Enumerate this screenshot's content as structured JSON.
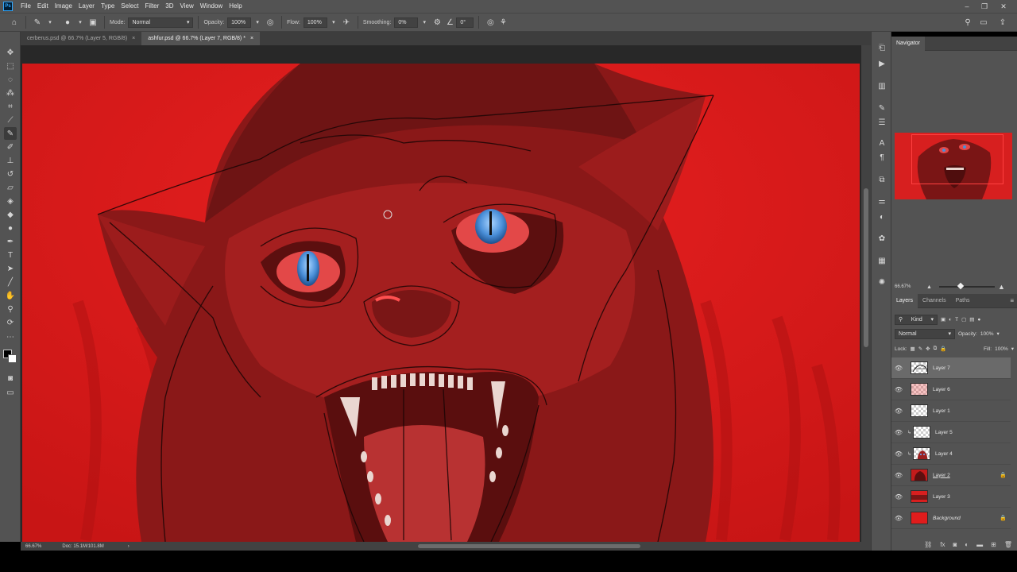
{
  "menubar": {
    "logo": "Ps",
    "items": [
      "File",
      "Edit",
      "Image",
      "Layer",
      "Type",
      "Select",
      "Filter",
      "3D",
      "View",
      "Window",
      "Help"
    ],
    "window_controls": [
      "–",
      "❐",
      "✕"
    ]
  },
  "options": {
    "mode_label": "Mode:",
    "mode_value": "Normal",
    "opacity_label": "Opacity:",
    "opacity_value": "100%",
    "flow_label": "Flow:",
    "flow_value": "100%",
    "smoothing_label": "Smoothing:",
    "smoothing_value": "0%",
    "angle_value": "0°"
  },
  "tabs": [
    {
      "label": "cerberus.psd @ 66.7% (Layer 5, RGB/8)",
      "close": "×",
      "active": false
    },
    {
      "label": "ashfur.psd @ 66.7% (Layer 7, RGB/8) *",
      "close": "×",
      "active": true
    }
  ],
  "status": {
    "zoom": "66.67%",
    "doc": "Doc: 15.1M/101.8M"
  },
  "navigator": {
    "title": "Navigator",
    "zoom": "66.67%"
  },
  "layers_panel": {
    "tabs": [
      "Layers",
      "Channels",
      "Paths"
    ],
    "filter_kind": "Kind",
    "blend_mode": "Normal",
    "opacity_label": "Opacity:",
    "opacity_value": "100%",
    "lock_label": "Lock:",
    "fill_label": "Fill:",
    "fill_value": "100%",
    "layers": [
      {
        "name": "Layer 7",
        "selected": true,
        "locked": false,
        "clipped": false
      },
      {
        "name": "Layer 6",
        "selected": false,
        "locked": false,
        "clipped": false
      },
      {
        "name": "Layer 1",
        "selected": false,
        "locked": false,
        "clipped": false
      },
      {
        "name": "Layer 5",
        "selected": false,
        "locked": false,
        "clipped": true
      },
      {
        "name": "Layer 4",
        "selected": false,
        "locked": false,
        "clipped": true
      },
      {
        "name": "Layer 2",
        "selected": false,
        "locked": true,
        "clipped": false
      },
      {
        "name": "Layer 3",
        "selected": false,
        "locked": false,
        "clipped": false
      },
      {
        "name": "Background",
        "selected": false,
        "locked": true,
        "clipped": false
      }
    ]
  },
  "colors": {
    "canvas_red": "#e01c1c",
    "shadow_red": "#6e1414",
    "eye_blue": "#4a8fd8"
  }
}
